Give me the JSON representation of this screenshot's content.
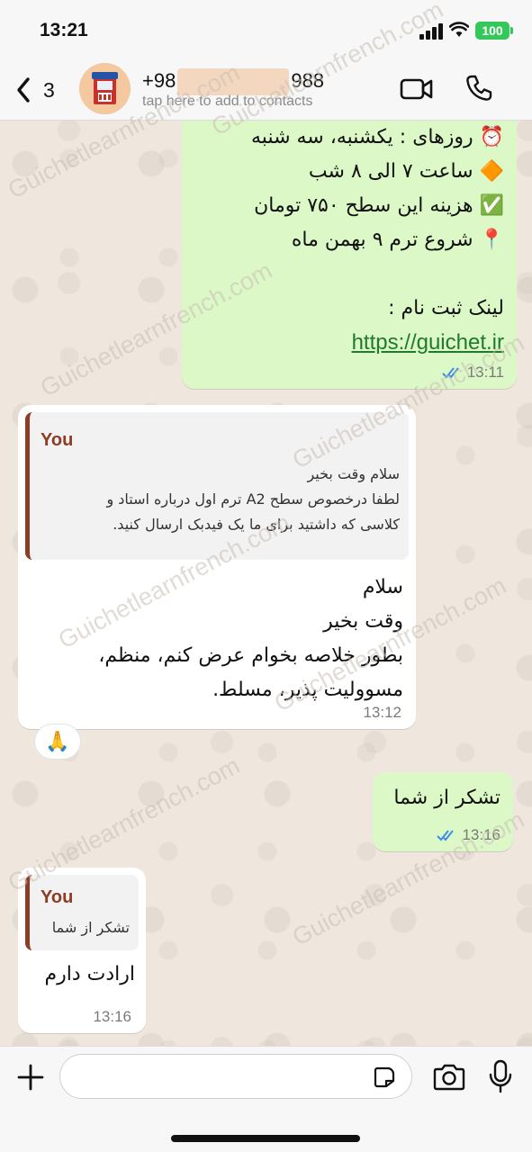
{
  "status_bar": {
    "time": "13:21",
    "battery": "100"
  },
  "header": {
    "back_count": "3",
    "contact_prefix": "+98",
    "contact_suffix": "988",
    "subtitle": "tap here to add to contacts"
  },
  "watermark": "Guichetlearnfrench.com",
  "messages": {
    "m1": {
      "lines": [
        "⏰ روزهای : یکشنبه، سه شنبه",
        "🔶 ساعت ۷ الی ۸ شب",
        "✅ هزینه این سطح ۷۵۰ تومان",
        "📍 شروع ترم ۹ بهمن ماه",
        "",
        "لینک ثبت نام :"
      ],
      "link": "https://guichet.ir",
      "time": "13:11"
    },
    "m2": {
      "quote_author": "You",
      "quote_lines": [
        "سلام وقت بخیر",
        "لطفا درخصوص سطح A2 ترم اول درباره استاد و",
        "کلاسی که داشتید برای ما یک فیدبک ارسال کنید."
      ],
      "lines": [
        "سلام",
        "وقت بخیر",
        "بطور خلاصه بخوام عرض کنم، منظم،",
        "مسوولیت پذیر، مسلط."
      ],
      "time": "13:12",
      "reaction": "🙏"
    },
    "m3": {
      "text": "تشکر از شما",
      "time": "13:16"
    },
    "m4": {
      "quote_author": "You",
      "quote_text": "تشکر از شما",
      "text": "ارادت دارم",
      "time": "13:16"
    }
  },
  "colors": {
    "outgoing_bubble": "#dcf8c6",
    "incoming_bubble": "#ffffff",
    "quote_accent": "#8b3d25",
    "read_ticks": "#3b8de8",
    "battery": "#34c759"
  },
  "icons": {
    "back": "chevron-left-icon",
    "video": "video-camera-icon",
    "call": "phone-icon",
    "plus": "plus-icon",
    "sticker": "sticker-icon",
    "camera": "camera-icon",
    "mic": "microphone-icon"
  }
}
